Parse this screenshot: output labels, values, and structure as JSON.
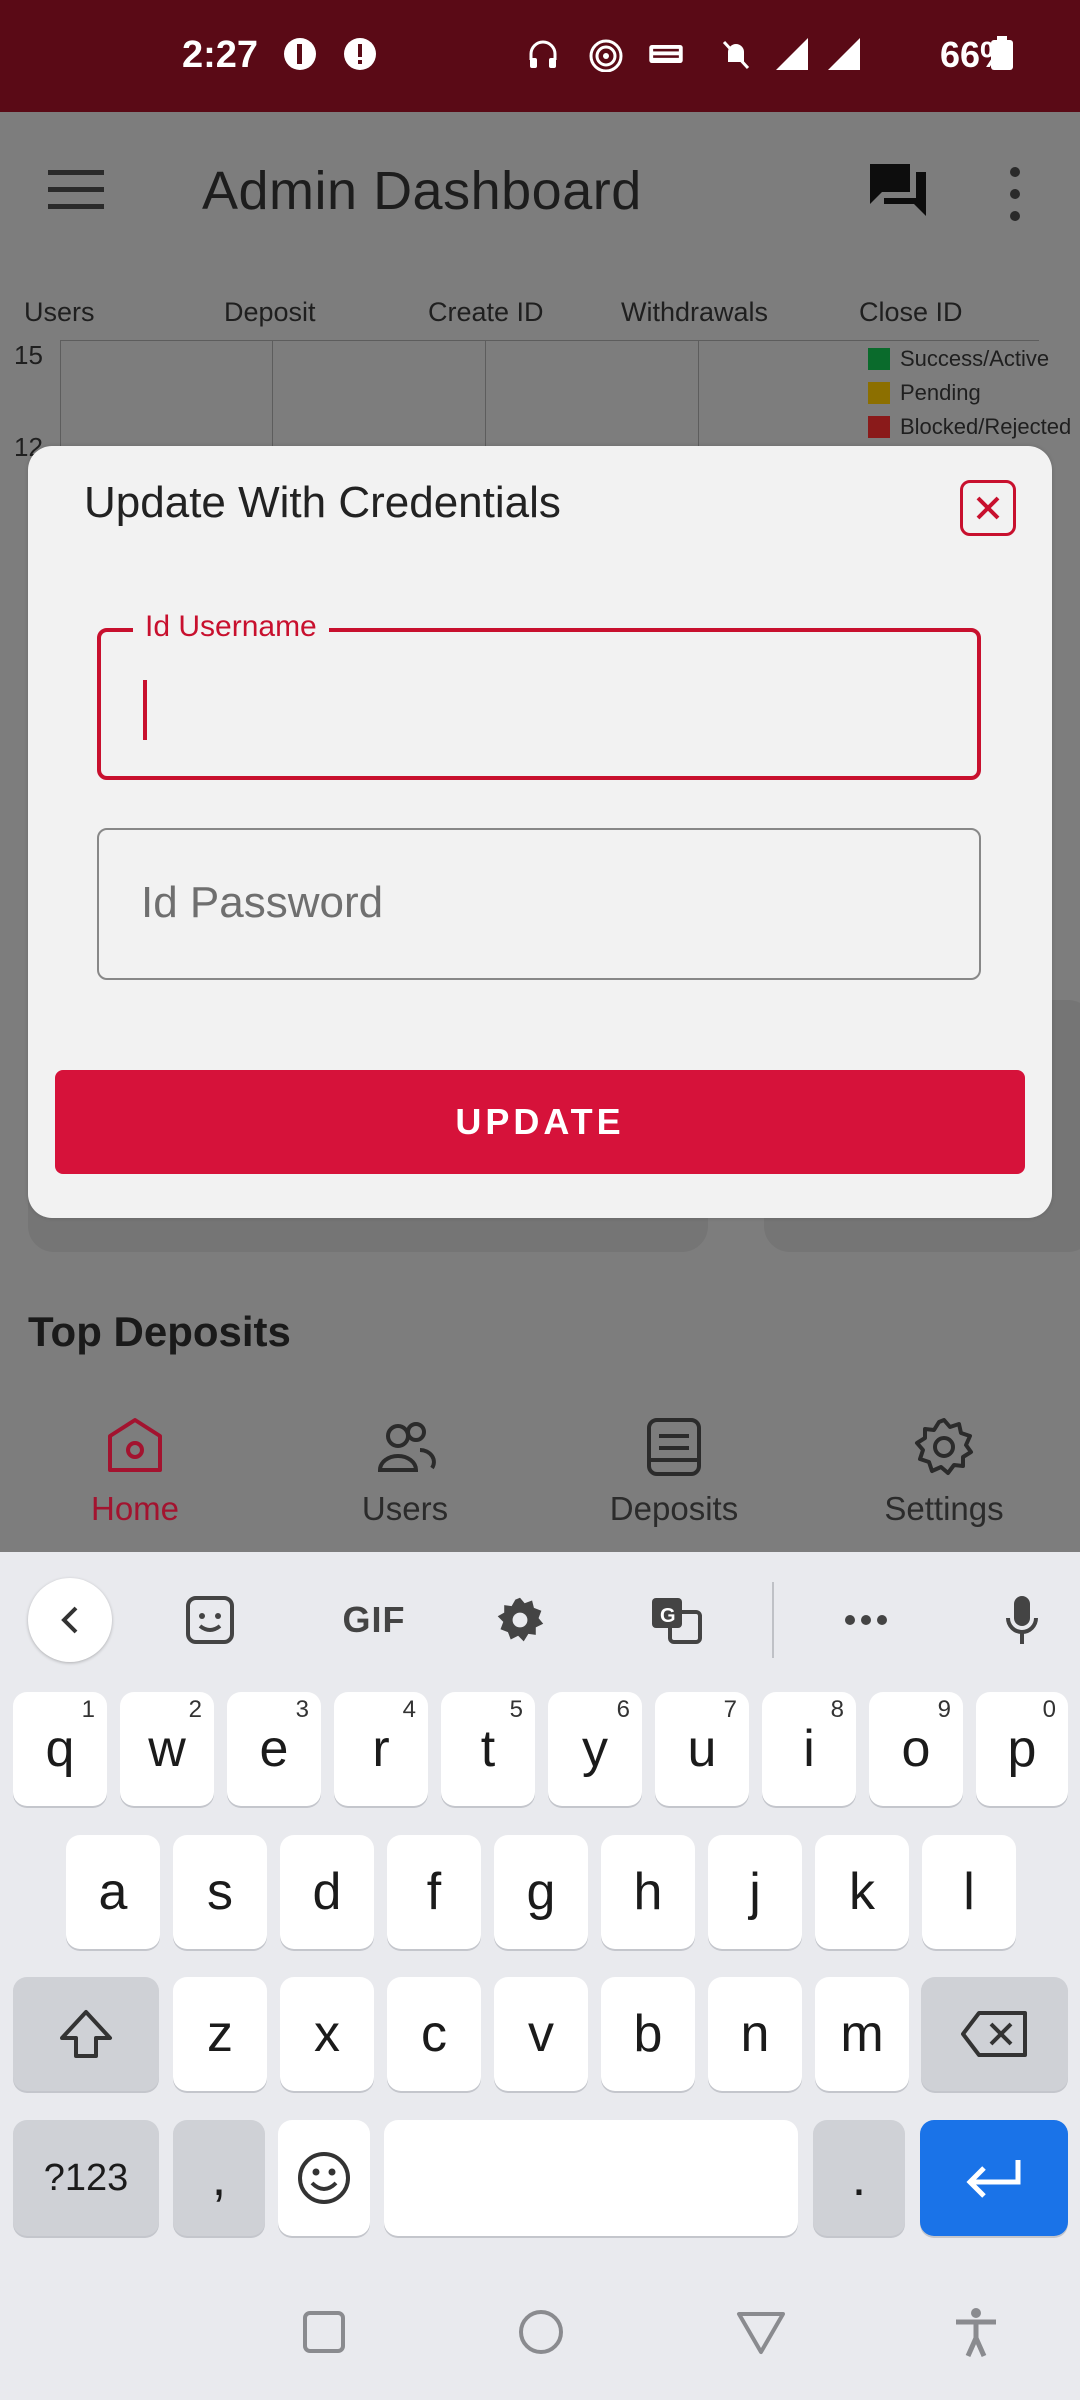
{
  "status_bar": {
    "time": "2:27",
    "battery": "66%"
  },
  "app_bar": {
    "title": "Admin Dashboard"
  },
  "tabs": [
    "Users",
    "Deposit",
    "Create ID",
    "Withdrawals",
    "Close ID"
  ],
  "chart_axis": {
    "tick_15": "15",
    "tick_12": "12"
  },
  "legend": [
    {
      "label": "Success/Active",
      "color": "#0a6b2c"
    },
    {
      "label": "Pending",
      "color": "#8c6f00"
    },
    {
      "label": "Blocked/Rejected",
      "color": "#8a1a1a"
    }
  ],
  "section": {
    "top_deposits": "Top Deposits"
  },
  "bottom_nav": [
    {
      "label": "Home",
      "icon": "home-icon"
    },
    {
      "label": "Users",
      "icon": "users-icon"
    },
    {
      "label": "Deposits",
      "icon": "deposits-icon"
    },
    {
      "label": "Settings",
      "icon": "settings-icon"
    }
  ],
  "modal": {
    "title": "Update With Credentials",
    "username_label": "Id Username",
    "username_value": "",
    "password_placeholder": "Id Password",
    "update_button": "UPDATE"
  },
  "keyboard": {
    "toolbar": {
      "gif": "GIF"
    },
    "row1": [
      "q",
      "w",
      "e",
      "r",
      "t",
      "y",
      "u",
      "i",
      "o",
      "p"
    ],
    "row1_hints": [
      "1",
      "2",
      "3",
      "4",
      "5",
      "6",
      "7",
      "8",
      "9",
      "0"
    ],
    "row2": [
      "a",
      "s",
      "d",
      "f",
      "g",
      "h",
      "j",
      "k",
      "l"
    ],
    "row3": [
      "z",
      "x",
      "c",
      "v",
      "b",
      "n",
      "m"
    ],
    "symbols_key": "?123",
    "comma_key": ",",
    "period_key": "."
  }
}
